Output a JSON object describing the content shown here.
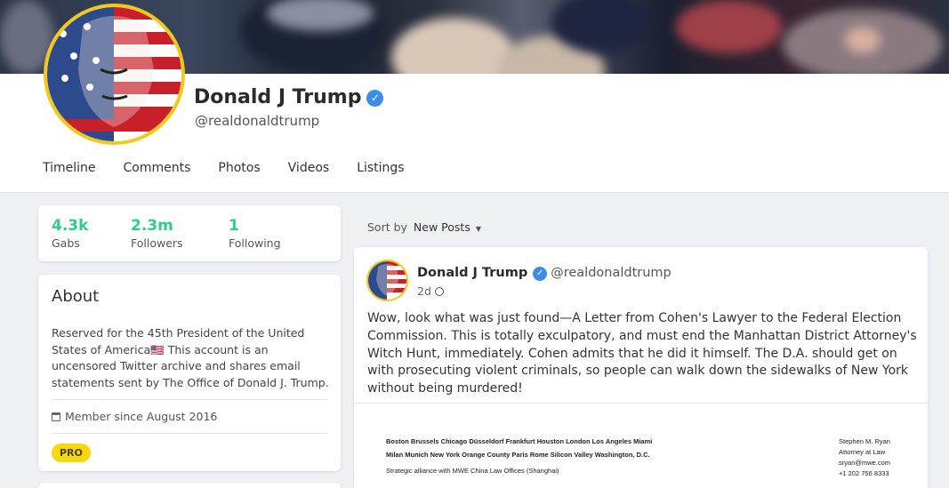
{
  "profile": {
    "name": "Donald J Trump",
    "handle": "@realdonaldtrump",
    "verified": true
  },
  "tabs": [
    "Timeline",
    "Comments",
    "Photos",
    "Videos",
    "Listings"
  ],
  "stats": [
    {
      "value": "4.3k",
      "label": "Gabs"
    },
    {
      "value": "2.3m",
      "label": "Followers"
    },
    {
      "value": "1",
      "label": "Following"
    }
  ],
  "about": {
    "title": "About",
    "bio": "Reserved for the 45th President of the United States of America🇺🇸 This account is an uncensored Twitter archive and shares email statements sent by The Office of Donald J. Trump.",
    "member_since": "Member since August 2016",
    "badge": "PRO"
  },
  "feed": {
    "sort_label": "Sort by",
    "sort_value": "New Posts"
  },
  "post": {
    "author": "Donald J Trump",
    "handle": "@realdonaldtrump",
    "time": "2d",
    "text": "Wow, look what was just found—A Letter from Cohen's Lawyer to the Federal Election Commission. This is totally exculpatory, and must end the Manhattan District Attorney's Witch Hunt, immediately. Cohen admits that he did it himself. The D.A. should get on with prosecuting violent criminals, so people can walk down the sidewalks of New York without being murdered!",
    "attachment": {
      "offices_line1": "Boston  Brussels  Chicago  Düsseldorf  Frankfurt  Houston  London  Los Angeles  Miami",
      "offices_line2": "Milan  Munich  New York  Orange County  Paris  Rome  Silicon Valley  Washington, D.C.",
      "offices_line3": "Strategic alliance with MWE China Law Offices (Shanghai)",
      "signer_name": "Stephen M. Ryan",
      "signer_title": "Attorney at Law",
      "signer_email": "sryan@mwe.com",
      "signer_phone": "+1 202 756 8333"
    }
  },
  "colors": {
    "accent_green": "#2ecc85",
    "verified_blue": "#3b8de8",
    "pro_yellow": "#ffd60a",
    "avatar_ring": "#f2c81e"
  }
}
